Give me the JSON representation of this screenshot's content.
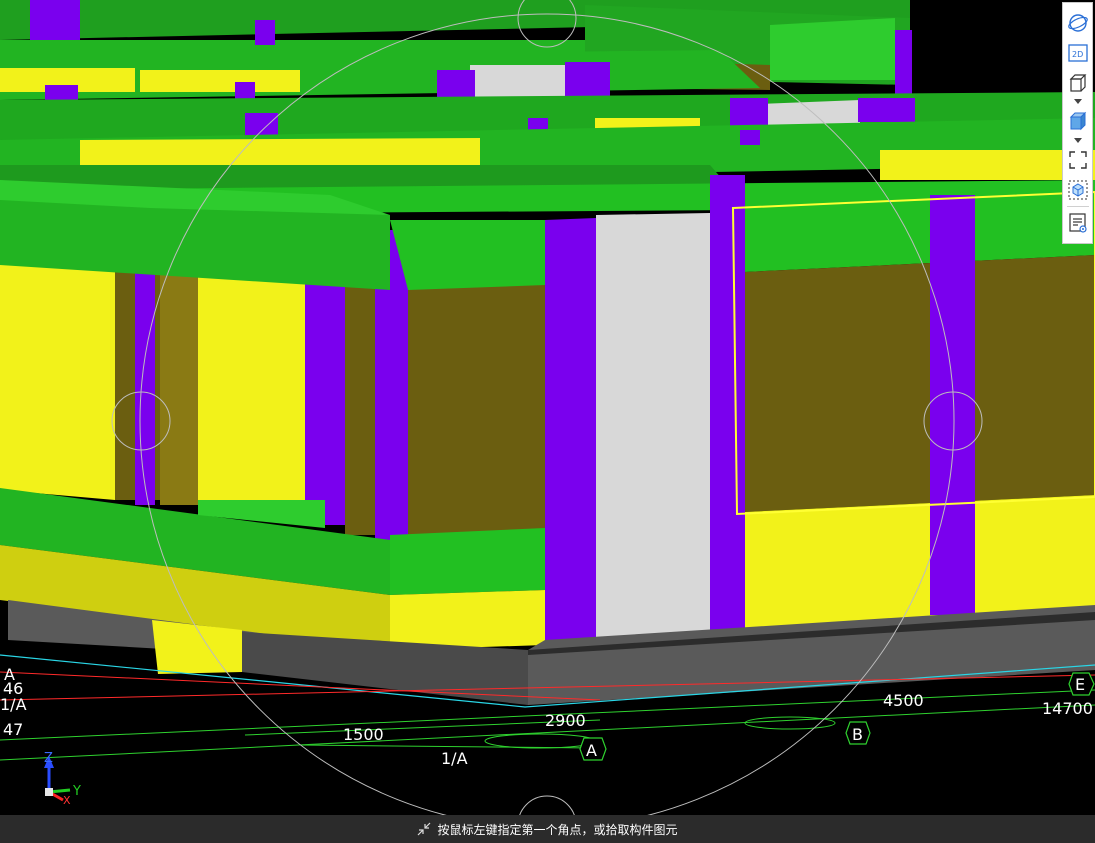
{
  "viewport": {
    "grid_labels": {
      "dim_1500": "1500",
      "dim_2900": "2900",
      "dim_4500": "4500",
      "dim_14700": "14700",
      "axis_1A": "1/A",
      "left_46": "46",
      "left_1A": "1/A",
      "left_47": "47",
      "left_A": "A"
    },
    "grid_bubbles": {
      "A": "A",
      "B": "B",
      "E": "E"
    },
    "axes": {
      "z": "Z",
      "y": "Y",
      "x": "X"
    }
  },
  "toolbar": {
    "buttons": [
      {
        "name": "orbit-icon",
        "label": "orbit"
      },
      {
        "name": "view-2d-icon",
        "label": "2D"
      },
      {
        "name": "view-3d-box-icon",
        "label": "3d view"
      },
      {
        "name": "solid-box-icon",
        "label": "shaded"
      },
      {
        "name": "full-extent-icon",
        "label": "fit"
      },
      {
        "name": "dashed-cube-icon",
        "label": "local 3d"
      },
      {
        "name": "properties-icon",
        "label": "properties"
      }
    ],
    "label_2d": "2D"
  },
  "status": {
    "text": "按鼠标左键指定第一个角点，或拾取构件图元"
  },
  "colors": {
    "beam_green": "#22c022",
    "beam_top_green": "#2ecc2e",
    "column_purple": "#7a00ee",
    "slab_yellow": "#f2f21a",
    "wall_olive": "#6b5e10",
    "foundation_gray": "#5a5a5a",
    "grid_green": "#2fd12f",
    "grid_red": "#ff2a2a",
    "selection_yellow": "#ffff33",
    "status_bg": "#2b2b2b"
  }
}
